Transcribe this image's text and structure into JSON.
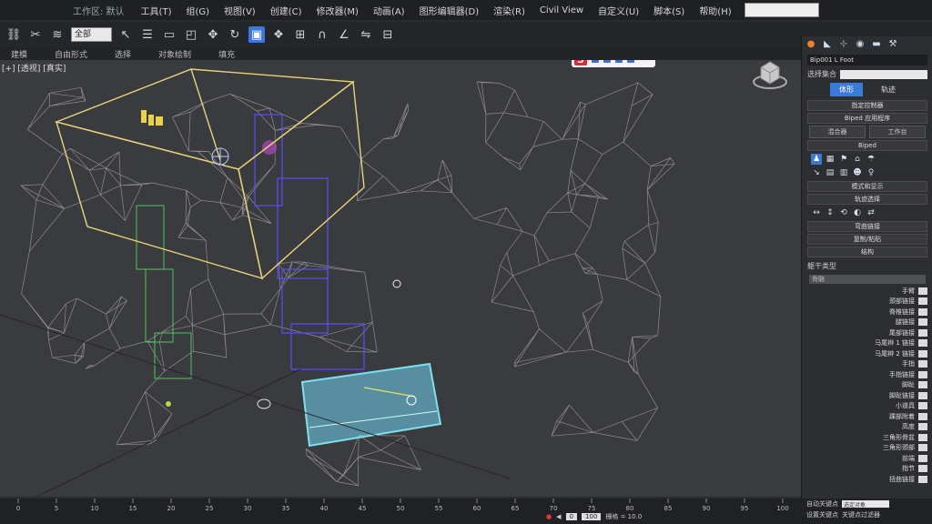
{
  "app": {
    "title": "工作区: 默认"
  },
  "menu": {
    "items": [
      "工具(T)",
      "组(G)",
      "视图(V)",
      "创建(C)",
      "修改器(M)",
      "动画(A)",
      "图形编辑器(D)",
      "渲染(R)",
      "Civil View",
      "自定义(U)",
      "脚本(S)",
      "帮助(H)"
    ]
  },
  "toolbar": {
    "filter_select": "全部"
  },
  "ribbon": {
    "items": [
      "建模",
      "自由形式",
      "选择",
      "对象绘制",
      "填充"
    ]
  },
  "viewport": {
    "label": "[+] [透视] [真实]"
  },
  "ime": {
    "logo": "S"
  },
  "command_panel": {
    "object_name": "Bip001 L Foot",
    "selection_set_label": "选择集合",
    "tab_figure": "体形",
    "tab_track": "轨迹",
    "rollout_assign_controller": "指定控制器",
    "rollout_biped_apps": "Biped 应用程序",
    "btn_mixer": "混合器",
    "btn_workbench": "工作台",
    "rollout_biped": "Biped",
    "rollout_mode_display": "模式和显示",
    "rollout_track_select": "轨迹选择",
    "rollout_copy_paste": "复制/粘贴",
    "rollout_link_select": "弯曲链接",
    "rollout_structure": "结构",
    "body_type_label": "躯干类型",
    "body_type_value": "骨骼",
    "structure_rows": [
      "手臂",
      "颈部链接",
      "脊椎链接",
      "腿链接",
      "尾部链接",
      "马尾辫 1 链接",
      "马尾辫 2 链接",
      "手指",
      "手指链接",
      "脚趾",
      "脚趾链接",
      "小道具",
      "踝部附着",
      "高度",
      "三角形骨盆",
      "三角形颈部",
      "前端",
      "指节",
      "扭曲链接"
    ]
  },
  "timeline": {
    "ticks": [
      "0",
      "5",
      "10",
      "15",
      "20",
      "25",
      "30",
      "35",
      "40",
      "45",
      "50",
      "55",
      "60",
      "65",
      "70",
      "75",
      "80",
      "85",
      "90",
      "95",
      "100"
    ],
    "frame_start": "0",
    "frame_display": "100",
    "grid_label": "栅格 = 10.0"
  },
  "status": {
    "auto_key": "自动关键点",
    "set_key": "设置关键点",
    "selected_label": "选定对象",
    "key_filters": "关键点过滤器"
  },
  "colors": {
    "viewport_bg": "#3a3b3e",
    "selection_yellow": "#e8d27a",
    "selected_cyan": "#7fe0f0",
    "biped_blue": "#5a4cff",
    "biped_green": "#4cc45a",
    "accent_blue": "#3b7ad6"
  }
}
